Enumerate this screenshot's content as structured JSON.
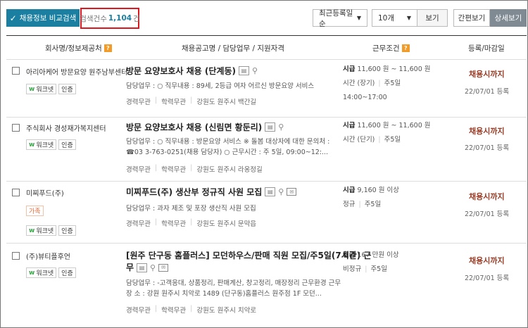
{
  "toolbar": {
    "compare_label": "채용정보 비교검색",
    "count_label": "검색건수",
    "count_value": "1,104",
    "count_unit": "건",
    "sort_value": "최근등록일순",
    "page_size_value": "10개",
    "view_button": "보기",
    "simple_view": "간편보기",
    "detail_view": "상세보기"
  },
  "header": {
    "company": "회사명/정보제공처",
    "title": "채용공고명 / 담당업무 / 지원자격",
    "conditions": "근무조건",
    "registered": "등록/마감일"
  },
  "rows": [
    {
      "company": "아리아케어 방문요양 원주남부센터",
      "badges": [
        "워크넷",
        "인증"
      ],
      "title": "방문 요양보호사 채용 (단계동)",
      "duty": "담당업무 : ○ 직무내용 : 89세, 2등급 여자 어르신 방문요양 서비스",
      "meta": [
        "경력무관",
        "학력무관",
        "강원도 원주시 백간길"
      ],
      "pay_label": "시급",
      "pay": "11,600 원 ~ 11,600 원",
      "cond1": "시간 (장기)",
      "cond2": "주5일",
      "cond3": "14:00~17:00",
      "status": "채용시까지",
      "date": "22/07/01 등록"
    },
    {
      "company": "주식회사 경성재가복지센터",
      "badges": [
        "워크넷",
        "인증"
      ],
      "title": "방문 요양보호사 채용 (신림면 황둔리)",
      "duty": "담당업무 : ○ 직무내용 : 방문요양 서비스 ※ 돌봄 대상자에 대한 문의처 : ☎03 3-763-0251(채용 담당자) ○ 근무시간 : 주 5일, 09:00~12:...",
      "meta": [
        "경력무관",
        "학력무관",
        "강원도 원주시 라옹정길"
      ],
      "pay_label": "시급",
      "pay": "11,600 원 ~ 11,600 원",
      "cond1": "시간 (단기)",
      "cond2": "주5일",
      "status": "채용시까지",
      "date": "22/07/01 등록"
    },
    {
      "company": "미찌푸드(주)",
      "badges": [
        "가족",
        "워크넷",
        "인증"
      ],
      "title": "미찌푸드(주) 생산부 정규직 사원 모집",
      "duty": "담당업무 : 과자 제조 및 포장 생산직 사원 모집",
      "meta": [
        "경력무관",
        "학력무관",
        "강원도 원주시 문막읍"
      ],
      "pay_label": "시급",
      "pay": "9,160 원 이상",
      "cond1": "정규",
      "cond2": "주5일",
      "status": "채용시까지",
      "date": "22/07/01 등록"
    },
    {
      "company": "(주)뷰티플후언",
      "badges": [
        "워크넷",
        "인증"
      ],
      "title_line1": "[원주 단구동 홈플러스] 모던하우스/판매 직원 모집/주5일(7시간) 근",
      "title_line2": "무",
      "duty": "담당업무 : -고객응대, 상품정리, 판매계산, 창고정리, 매장정리 근무환경 근무장 소 : 강원 원주시 치악로 1489 (단구동)홈플러스 원주점 1F 모던...",
      "meta": [
        "경력무관",
        "학력무관",
        "강원도 원주시 치악로"
      ],
      "pay_label": "월급",
      "pay": "167 만원 이상",
      "cond1": "비정규",
      "cond2": "주5일",
      "status": "채용시까지",
      "date": "22/07/01 등록"
    }
  ]
}
